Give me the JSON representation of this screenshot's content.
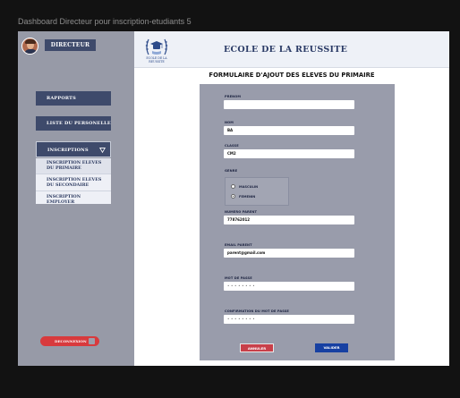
{
  "frame": {
    "title": "Dashboard Directeur pour inscription-etudiants 5"
  },
  "sidebar": {
    "role": "DIRECTEUR",
    "nav": {
      "rapports": "RAPPORTS",
      "personnel": "LISTE DU PERSONELLE",
      "inscriptions": "INSCRIPTIONS"
    },
    "submenu": [
      {
        "label": "INSCRIPTION ELEVES DU PRIMAIRE"
      },
      {
        "label": "INSCRIPTION ELEVES DU SECONDAIRE"
      },
      {
        "label": "INSCRIPTION EMPLOYER"
      }
    ],
    "logout": "DECONNEXION"
  },
  "header": {
    "logo_text": "ECOLE DE LA REUSSITE",
    "school_name": "ECOLE DE LA REUSSITE"
  },
  "form": {
    "title": "FORMULAIRE D'AJOUT DES ELEVES DU PRIMAIRE",
    "fields": {
      "prenom": {
        "label": "PRENOM",
        "value": ""
      },
      "nom": {
        "label": "NOM",
        "value": "BA"
      },
      "classe": {
        "label": "CLASSE",
        "value": "CM2"
      },
      "numero_parent": {
        "label": "NUMERO PARENT",
        "value": "778762012"
      },
      "email_parent": {
        "label": "EMAIL PARENT",
        "value": "parent@gmail.com"
      },
      "mot_de_passe": {
        "label": "MOT DE PASSE",
        "value": "• • • • • • • •"
      },
      "confirmation": {
        "label": "CONFIRMATION DU MOT DE PASSE",
        "value": "• • • • • • • •"
      }
    },
    "genre": {
      "label": "GENRE",
      "options": [
        {
          "label": "MASCULIN",
          "selected": false
        },
        {
          "label": "FEMENIN",
          "selected": true
        }
      ]
    },
    "buttons": {
      "cancel": "ANNULER",
      "validate": "VALIDER"
    }
  },
  "colors": {
    "sidebar_bg": "#979aa7",
    "nav_bg": "#3e4a6b",
    "logout_red": "#d83a3d",
    "cancel_red": "#c8404a",
    "validate_blue": "#1740a2",
    "form_card_bg": "#999cab"
  }
}
